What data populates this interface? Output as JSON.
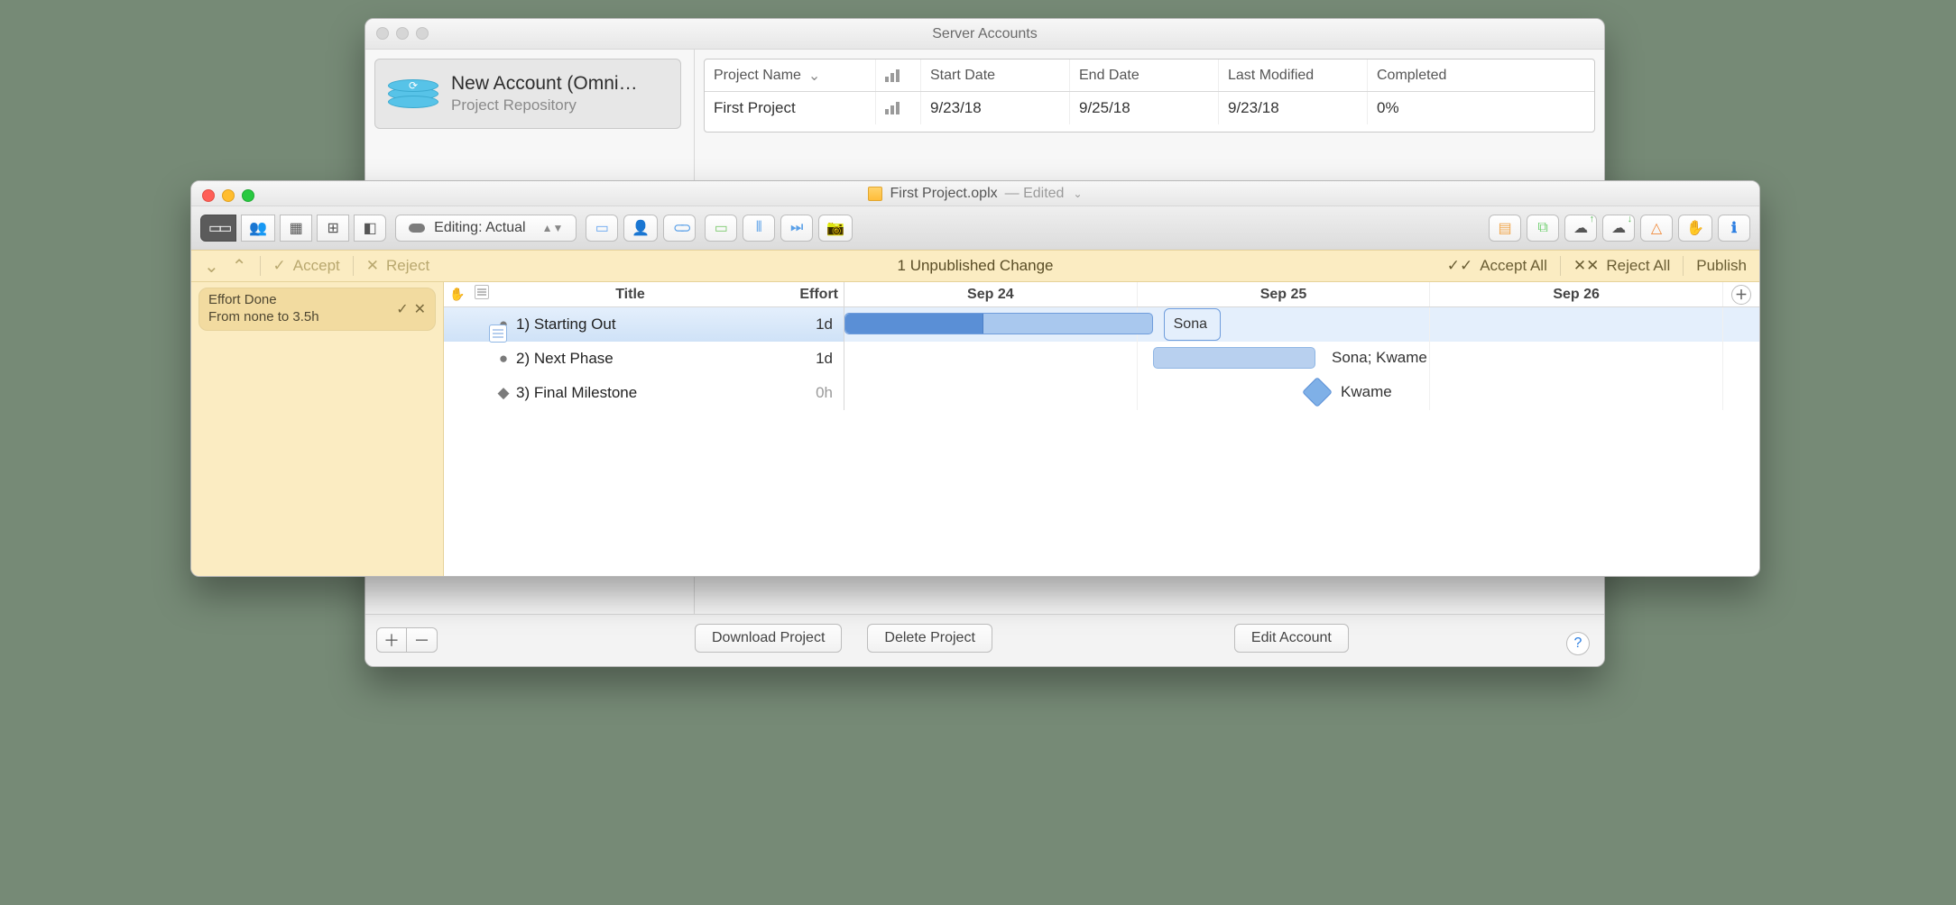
{
  "back_window": {
    "title": "Server Accounts",
    "sidebar": {
      "account_name": "New Account (Omni…",
      "account_sub": "Project Repository"
    },
    "table": {
      "headers": {
        "project_name": "Project Name",
        "start_date": "Start Date",
        "end_date": "End Date",
        "last_modified": "Last Modified",
        "completed": "Completed"
      },
      "rows": [
        {
          "project_name": "First Project",
          "start_date": "9/23/18",
          "end_date": "9/25/18",
          "last_modified": "9/23/18",
          "completed": "0%"
        }
      ]
    },
    "buttons": {
      "download": "Download Project",
      "delete": "Delete Project",
      "edit": "Edit Account"
    }
  },
  "front_window": {
    "doc_name": "First Project.oplx",
    "edited": " — Edited",
    "mode_label": "Editing: Actual",
    "change_bar": {
      "accept": "Accept",
      "reject": "Reject",
      "summary": "1 Unpublished Change",
      "accept_all": "Accept All",
      "reject_all": "Reject All",
      "publish": "Publish"
    },
    "changes": [
      {
        "line1": "Effort Done",
        "line2": "From none to 3.5h"
      }
    ],
    "outline_headers": {
      "title": "Title",
      "effort": "Effort"
    },
    "timeline_headers": [
      "Sep 24",
      "Sep 25",
      "Sep 26"
    ],
    "tasks": [
      {
        "num": "1)",
        "title": "Starting Out",
        "effort": "1d",
        "assignees": "Sona"
      },
      {
        "num": "2)",
        "title": "Next Phase",
        "effort": "1d",
        "assignees": "Sona; Kwame"
      },
      {
        "num": "3)",
        "title": "Final Milestone",
        "effort": "0h",
        "assignees": "Kwame"
      }
    ]
  }
}
